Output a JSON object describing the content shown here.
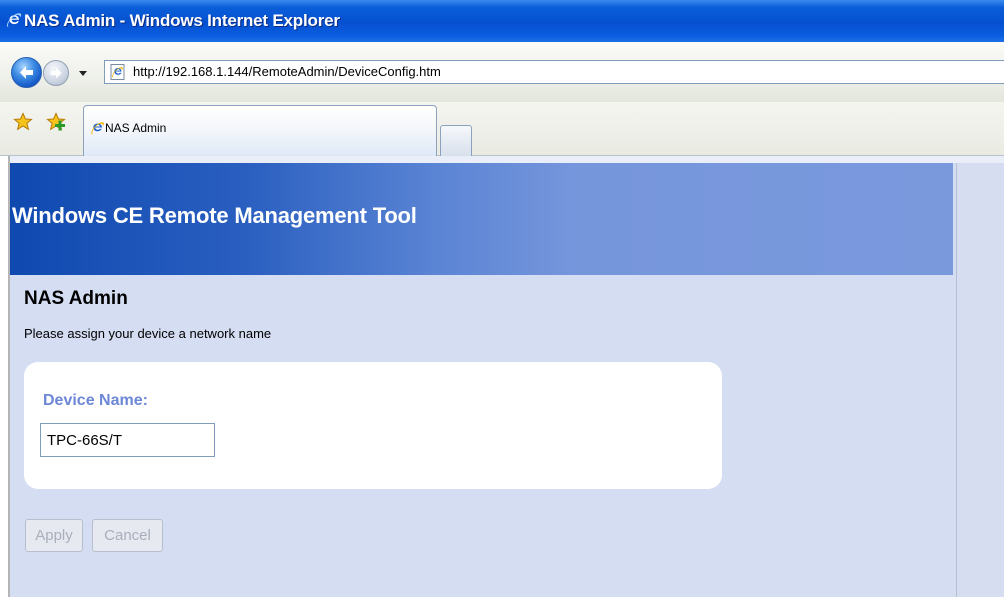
{
  "window": {
    "title": "NAS Admin - Windows Internet Explorer",
    "icon": "ie-logo-icon"
  },
  "navigation": {
    "back_icon": "back-arrow-icon",
    "forward_icon": "forward-arrow-icon",
    "history_icon": "chevron-down-icon",
    "address": {
      "page_icon": "ie-page-icon",
      "url": "http://192.168.1.144/RemoteAdmin/DeviceConfig.htm"
    }
  },
  "favorites_bar": {
    "favorites_icon": "favorites-star-icon",
    "add_favorite_icon": "add-favorite-icon"
  },
  "tabs": [
    {
      "label": "NAS Admin",
      "icon": "ie-page-icon",
      "active": true
    }
  ],
  "new_tab_icon": "new-tab-icon",
  "page": {
    "banner_title": "Windows CE Remote Management Tool",
    "heading": "NAS Admin",
    "subtitle": "Please assign your device a network name",
    "form": {
      "device_name_label": "Device Name:",
      "device_name_value": "TPC-66S/T"
    },
    "buttons": {
      "apply": "Apply",
      "cancel": "Cancel",
      "enabled": false
    }
  },
  "colors": {
    "banner_start": "#0f49b0",
    "banner_end": "#7a99dd",
    "page_background": "#d5ddf3",
    "field_label": "#6c87d6",
    "disabled_text": "#a9afbb"
  }
}
